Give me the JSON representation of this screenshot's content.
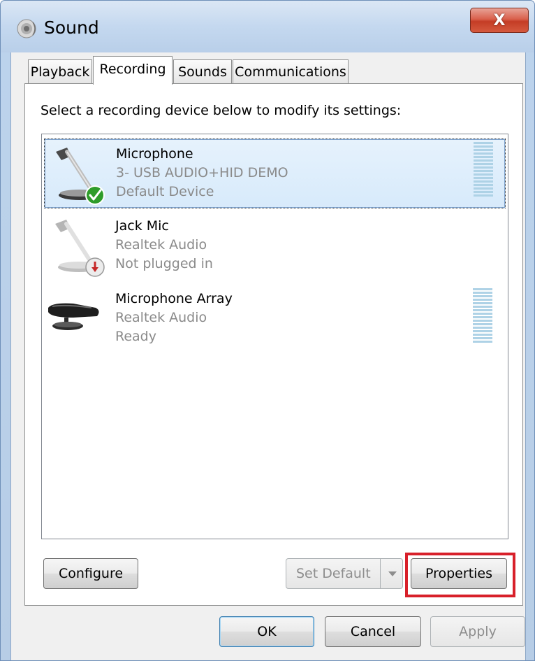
{
  "window": {
    "title": "Sound",
    "close_glyph": "X"
  },
  "tabs": [
    {
      "label": "Playback",
      "active": false
    },
    {
      "label": "Recording",
      "active": true
    },
    {
      "label": "Sounds",
      "active": false
    },
    {
      "label": "Communications",
      "active": false
    }
  ],
  "instruction": "Select a recording device below to modify its settings:",
  "devices": [
    {
      "name": "Microphone",
      "driver": "3- USB AUDIO+HID DEMO",
      "status": "Default Device",
      "icon": "microphone-icon",
      "badge": "default-check-badge-icon",
      "selected": true
    },
    {
      "name": "Jack Mic",
      "driver": "Realtek Audio",
      "status": "Not plugged in",
      "icon": "microphone-icon",
      "badge": "unplugged-badge-icon",
      "selected": false
    },
    {
      "name": "Microphone Array",
      "driver": "Realtek Audio",
      "status": "Ready",
      "icon": "microphone-array-icon",
      "badge": "",
      "selected": false
    }
  ],
  "buttons": {
    "configure": "Configure",
    "set_default": "Set Default",
    "properties": "Properties",
    "ok": "OK",
    "cancel": "Cancel",
    "apply": "Apply"
  },
  "colors": {
    "highlight": "#d8202a",
    "selection": "#d7eafb",
    "close": "#c43c25"
  }
}
